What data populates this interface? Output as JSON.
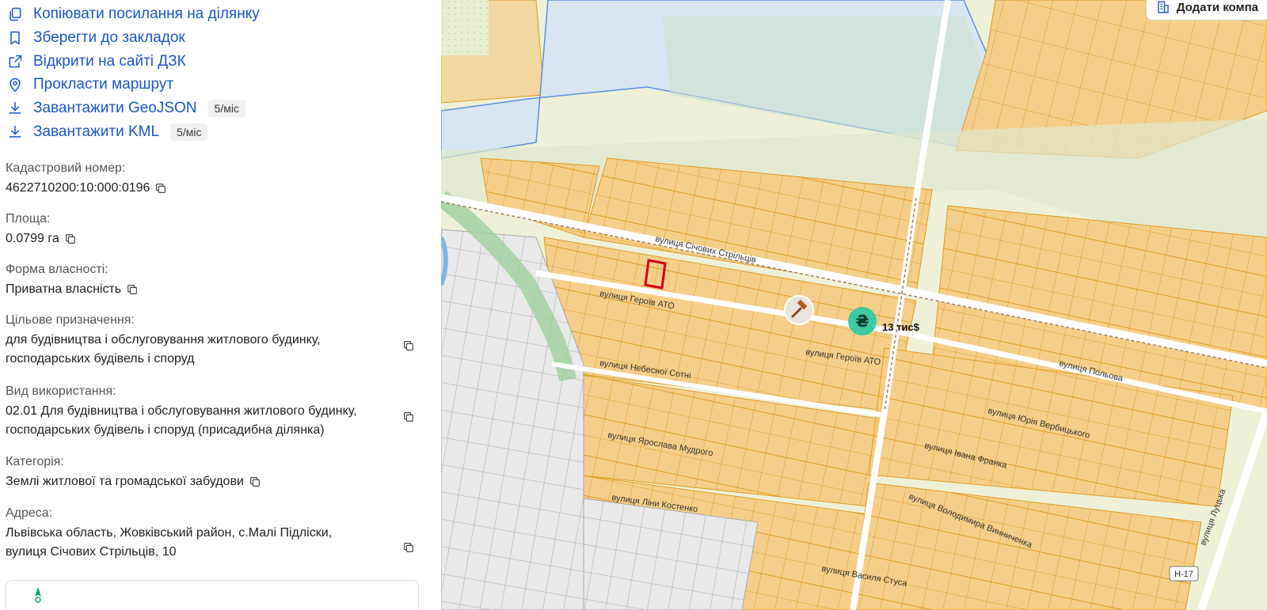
{
  "actions": [
    {
      "label": "Копіювати посилання на ділянку",
      "icon": "copy-link-icon"
    },
    {
      "label": "Зберегти до закладок",
      "icon": "bookmark-icon"
    },
    {
      "label": "Відкрити на сайті ДЗК",
      "icon": "external-link-icon"
    },
    {
      "label": "Прокласти маршрут",
      "icon": "map-pin-icon"
    },
    {
      "label": "Завантажити GeoJSON",
      "icon": "download-icon",
      "limit": "5/міс"
    },
    {
      "label": "Завантажити KML",
      "icon": "download-icon",
      "limit": "5/міс"
    }
  ],
  "fields": {
    "cadastral": {
      "label": "Кадастровий номер:",
      "value": "4622710200:10:000:0196"
    },
    "area": {
      "label": "Площа:",
      "value": "0.0799 га"
    },
    "ownership": {
      "label": "Форма власності:",
      "value": "Приватна власність"
    },
    "purpose": {
      "label": "Цільове призначення:",
      "lines": [
        "для будівництва і обслуговування житлового будинку,",
        "господарських будівель і споруд"
      ]
    },
    "usage": {
      "label": "Вид використання:",
      "lines": [
        "02.01 Для будівництва і обслуговування житлового будинку,",
        "господарських будівель і споруд (присадибна ділянка)"
      ]
    },
    "category": {
      "label": "Категорія:",
      "value": "Землі житлової та громадської забудови"
    },
    "address": {
      "label": "Адреса:",
      "lines": [
        "Львівська область, Жовківський район, с.Малі Підліски,",
        "вулиця Січових Стрільців, 10"
      ]
    }
  },
  "map": {
    "add_company": "Додати компа",
    "price_label": "13 тис$",
    "currency_symbol": "₴",
    "road_badge": "Н-17",
    "streets": [
      "вулиця Січових Стрільців",
      "вулиця Героїв АТО",
      "вулиця Героїв АТО",
      "вулиця Небесної Сотні",
      "вулиця Польова",
      "вулиця Юрія Вербицького",
      "вулиця Ярослава Мудрого",
      "вулиця Івана Франка",
      "вулиця Ліни Костенко",
      "вулиця Володимира Винниченка",
      "вулиця Василя Стуса",
      "вулиця Луцька"
    ]
  },
  "colors": {
    "link": "#1a56c7",
    "parcel_fill": "#f5cf8a",
    "parcel_stroke": "#e09a1e",
    "selected_parcel": "#d0021b",
    "price_badge": "#3cc9a4"
  }
}
